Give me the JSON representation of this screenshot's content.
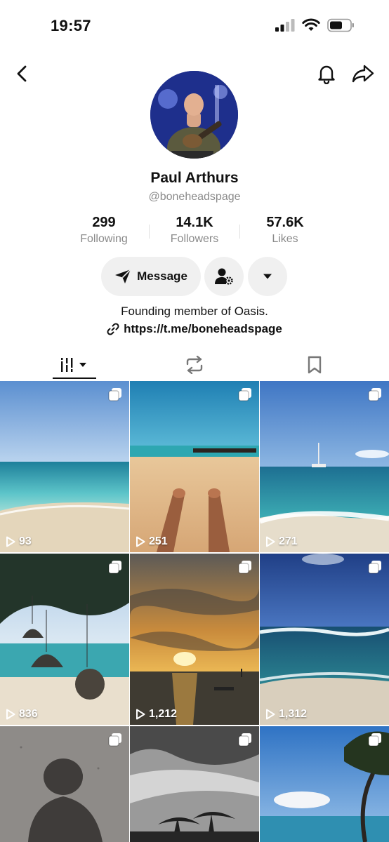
{
  "status_bar": {
    "time": "19:57"
  },
  "profile": {
    "display_name": "Paul Arthurs",
    "username": "@boneheadspage",
    "bio": "Founding member of Oasis.",
    "link": "https://t.me/boneheadspage"
  },
  "stats": [
    {
      "value": "299",
      "label": "Following"
    },
    {
      "value": "14.1K",
      "label": "Followers"
    },
    {
      "value": "57.6K",
      "label": "Likes"
    }
  ],
  "actions": {
    "message_label": "Message"
  },
  "tabs": [
    "videos",
    "reposts",
    "favorites"
  ],
  "videos": [
    {
      "views": "93",
      "scene": "beach-sea"
    },
    {
      "views": "251",
      "scene": "sand-feet"
    },
    {
      "views": "271",
      "scene": "sailboat"
    },
    {
      "views": "836",
      "scene": "hanging-lamps"
    },
    {
      "views": "1,212",
      "scene": "sunset"
    },
    {
      "views": "1,312",
      "scene": "waves"
    },
    {
      "views": "",
      "scene": "shadow"
    },
    {
      "views": "",
      "scene": "palm-bw"
    },
    {
      "views": "",
      "scene": "tree-sky"
    }
  ],
  "colors": {
    "stat_label": "#8a8a8a",
    "button_bg": "#f0f0f0"
  }
}
